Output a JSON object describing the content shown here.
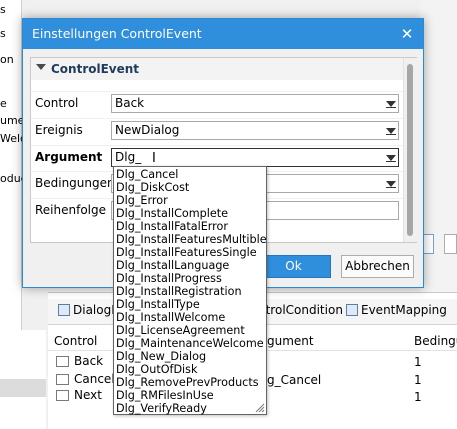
{
  "window": {
    "title": "Einstellungen ControlEvent",
    "close_glyph": "✕"
  },
  "property_grid": {
    "category": "ControlEvent",
    "rows": [
      {
        "label": "Control",
        "value": "Back"
      },
      {
        "label": "Ereignis",
        "value": "NewDialog"
      },
      {
        "label": "Argument",
        "value": "Dlg_"
      },
      {
        "label": "Bedingungen",
        "value": ""
      },
      {
        "label": "Reihenfolge",
        "value": ""
      }
    ]
  },
  "buttons": {
    "ok": "Ok",
    "cancel": "Abbrechen"
  },
  "dropdown_options": [
    "Dlg_Cancel",
    "Dlg_DiskCost",
    "Dlg_Error",
    "Dlg_InstallComplete",
    "Dlg_InstallFatalError",
    "Dlg_InstallFeaturesMultible",
    "Dlg_InstallFeaturesSingle",
    "Dlg_InstallLanguage",
    "Dlg_InstallProgress",
    "Dlg_InstallRegistration",
    "Dlg_InstallType",
    "Dlg_InstallWelcome",
    "Dlg_LicenseAgreement",
    "Dlg_MaintenanceWelcome",
    "Dlg_New_Dialog",
    "Dlg_OutOfDisk",
    "Dlg_RemovePrevProducts",
    "Dlg_RMFilesInUse",
    "Dlg_VerifyReady"
  ],
  "background": {
    "left_fragments": [
      "s",
      "s",
      "on",
      "e",
      "ument",
      "Welco",
      "oduc"
    ],
    "tabs": [
      "DialogItem",
      "ntrolCondition",
      "EventMapping"
    ],
    "grid_headers": {
      "control": "Control",
      "argument": "gument",
      "bedingung": "Bedingu"
    },
    "grid_rows": [
      {
        "control": "Back",
        "argument": "",
        "bedingung": "1"
      },
      {
        "control": "Cancel",
        "argument": "g_Cancel",
        "bedingung": "1"
      },
      {
        "control": "Next",
        "argument": "",
        "bedingung": "1"
      }
    ]
  }
}
